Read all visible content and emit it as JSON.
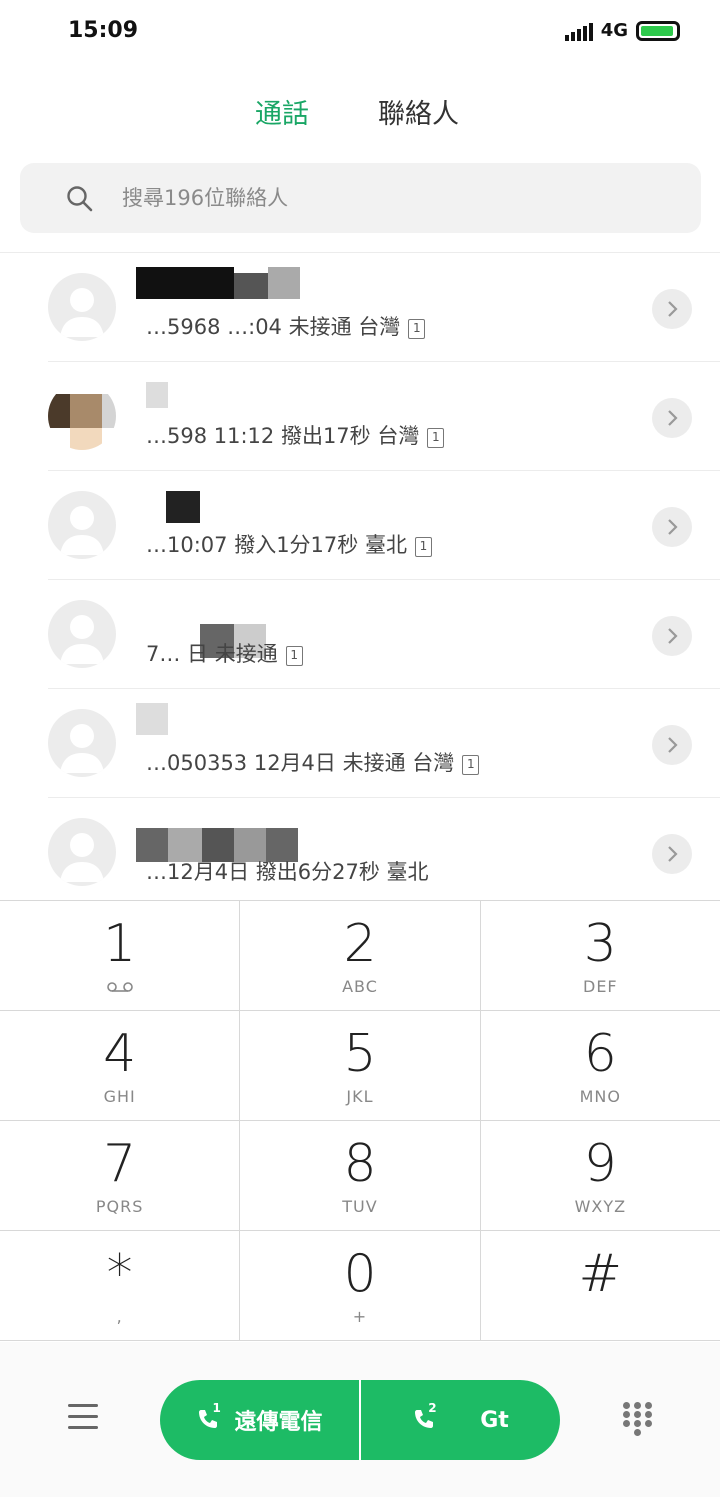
{
  "status": {
    "time": "15:09",
    "network": "4G"
  },
  "tabs": {
    "calls": "通話",
    "contacts": "聯絡人"
  },
  "search": {
    "placeholder": "搜尋196位聯絡人"
  },
  "calls": [
    {
      "detail": "…5968 …:04 未接通 台灣",
      "sim": "1"
    },
    {
      "detail": "…598 11:12 撥出17秒 台灣",
      "sim": "1"
    },
    {
      "detail": "…10:07 撥入1分17秒 臺北",
      "sim": "1"
    },
    {
      "detail": "7… 日 未接通",
      "sim": "1"
    },
    {
      "detail": "…050353 12月4日 未接通 台灣",
      "sim": "1"
    },
    {
      "detail": "…12月4日 撥出6分27秒 臺北",
      "sim": ""
    }
  ],
  "keypad": [
    [
      {
        "digit": "1",
        "letters": ""
      },
      {
        "digit": "2",
        "letters": "ABC"
      },
      {
        "digit": "3",
        "letters": "DEF"
      }
    ],
    [
      {
        "digit": "4",
        "letters": "GHI"
      },
      {
        "digit": "5",
        "letters": "JKL"
      },
      {
        "digit": "6",
        "letters": "MNO"
      }
    ],
    [
      {
        "digit": "7",
        "letters": "PQRS"
      },
      {
        "digit": "8",
        "letters": "TUV"
      },
      {
        "digit": "9",
        "letters": "WXYZ"
      }
    ],
    [
      {
        "digit": "*",
        "letters": ","
      },
      {
        "digit": "0",
        "letters": "+"
      },
      {
        "digit": "#",
        "letters": ""
      }
    ]
  ],
  "bottom": {
    "sim1_label": "遠傳電信",
    "sim1_number": "1",
    "sim2_label": "Gt",
    "sim2_number": "2"
  },
  "colors": {
    "accent": "#19a665",
    "call_button": "#1dbb65"
  }
}
